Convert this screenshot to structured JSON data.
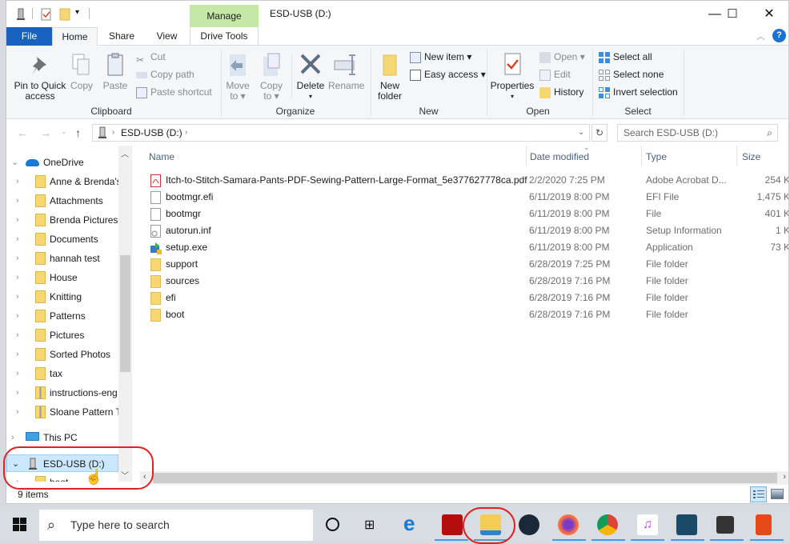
{
  "window": {
    "title": "ESD-USB (D:)",
    "contextual_tab_group": "Manage",
    "controls": {
      "minimize": "—",
      "maximize": "☐",
      "close": "✕"
    }
  },
  "tabs": [
    {
      "label": "File",
      "active": false
    },
    {
      "label": "Home",
      "active": true
    },
    {
      "label": "Share",
      "active": false
    },
    {
      "label": "View",
      "active": false
    },
    {
      "label": "Drive Tools",
      "active": false
    }
  ],
  "ribbon": {
    "clipboard": {
      "label": "Clipboard",
      "pin": "Pin to Quick access",
      "pin_line1": "Pin to Quick",
      "pin_line2": "access",
      "copy": "Copy",
      "paste": "Paste",
      "cut": "Cut",
      "copy_path": "Copy path",
      "paste_shortcut": "Paste shortcut"
    },
    "organize": {
      "label": "Organize",
      "move_to_1": "Move",
      "move_to_2": "to ▾",
      "copy_to_1": "Copy",
      "copy_to_2": "to ▾",
      "delete": "Delete",
      "rename": "Rename"
    },
    "new": {
      "label": "New",
      "new_folder_1": "New",
      "new_folder_2": "folder",
      "new_item": "New item ▾",
      "easy_access": "Easy access ▾"
    },
    "open": {
      "label": "Open",
      "properties": "Properties",
      "open": "Open ▾",
      "edit": "Edit",
      "history": "History"
    },
    "select": {
      "label": "Select",
      "select_all": "Select all",
      "select_none": "Select none",
      "invert": "Invert selection"
    }
  },
  "address": {
    "path": "ESD-USB (D:)",
    "search_placeholder": "Search ESD-USB (D:)"
  },
  "nav_pane": {
    "onedrive": "OneDrive",
    "onedrive_children": [
      {
        "label": "Anne & Brenda's",
        "type": "folder"
      },
      {
        "label": "Attachments",
        "type": "folder"
      },
      {
        "label": "Brenda Pictures",
        "type": "folder"
      },
      {
        "label": "Documents",
        "type": "folder"
      },
      {
        "label": "hannah test",
        "type": "folder"
      },
      {
        "label": "House",
        "type": "folder"
      },
      {
        "label": "Knitting",
        "type": "folder"
      },
      {
        "label": "Patterns",
        "type": "folder"
      },
      {
        "label": "Pictures",
        "type": "folder"
      },
      {
        "label": "Sorted Photos",
        "type": "folder"
      },
      {
        "label": "tax",
        "type": "folder"
      },
      {
        "label": "instructions-eng",
        "type": "zip"
      },
      {
        "label": "Sloane Pattern Te",
        "type": "zip"
      }
    ],
    "this_pc": "This PC",
    "selected_drive": "ESD-USB (D:)",
    "drive_child": "boot"
  },
  "columns": {
    "name": "Name",
    "date": "Date modified",
    "type": "Type",
    "size": "Size"
  },
  "files": [
    {
      "name": "Itch-to-Stitch-Samara-Pants-PDF-Sewing-Pattern-Large-Format_5e377627778ca.pdf",
      "date": "2/2/2020 7:25 PM",
      "type": "Adobe Acrobat D...",
      "size": "254 K",
      "icon": "pdf"
    },
    {
      "name": "bootmgr.efi",
      "date": "6/11/2019 8:00 PM",
      "type": "EFI File",
      "size": "1,475 K",
      "icon": "file"
    },
    {
      "name": "bootmgr",
      "date": "6/11/2019 8:00 PM",
      "type": "File",
      "size": "401 K",
      "icon": "file"
    },
    {
      "name": "autorun.inf",
      "date": "6/11/2019 8:00 PM",
      "type": "Setup Information",
      "size": "1 K",
      "icon": "settings-file"
    },
    {
      "name": "setup.exe",
      "date": "6/11/2019 8:00 PM",
      "type": "Application",
      "size": "73 K",
      "icon": "setup"
    },
    {
      "name": "support",
      "date": "6/28/2019 7:25 PM",
      "type": "File folder",
      "size": "",
      "icon": "folder"
    },
    {
      "name": "sources",
      "date": "6/28/2019 7:16 PM",
      "type": "File folder",
      "size": "",
      "icon": "folder"
    },
    {
      "name": "efi",
      "date": "6/28/2019 7:16 PM",
      "type": "File folder",
      "size": "",
      "icon": "folder"
    },
    {
      "name": "boot",
      "date": "6/28/2019 7:16 PM",
      "type": "File folder",
      "size": "",
      "icon": "folder"
    }
  ],
  "status": {
    "item_count": "9 items"
  },
  "taskbar": {
    "search_placeholder": "Type here to search",
    "apps": [
      "cortana",
      "task-view",
      "edge",
      "acrobat",
      "file-explorer",
      "steam",
      "firefox",
      "chrome",
      "itunes",
      "kindle",
      "sticky-notes",
      "office"
    ]
  },
  "colors": {
    "file_tab": "#1a62c0",
    "manage_tab": "#c6e8a6",
    "selection": "#cce8ff",
    "annotation": "#dd2222"
  }
}
